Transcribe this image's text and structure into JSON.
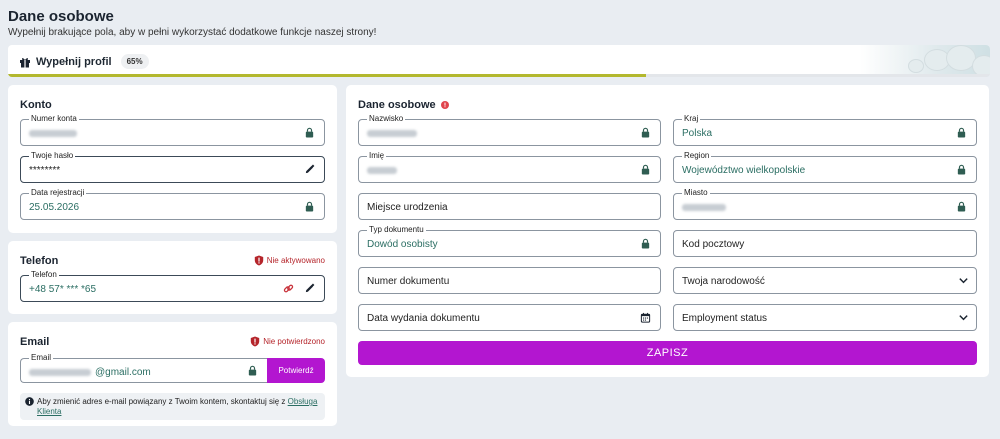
{
  "page": {
    "title": "Dane osobowe",
    "subtitle": "Wypełnij brakujące pola, aby w pełni wykorzystać dodatkowe funkcje naszej strony!"
  },
  "progress": {
    "label": "Wypełnij profil",
    "percent_label": "65%",
    "fraction": 0.65,
    "color": "#b3b82e"
  },
  "konto": {
    "title": "Konto",
    "account_number": {
      "label": "Numer konta"
    },
    "password": {
      "label": "Twoje hasło",
      "value": "********"
    },
    "registration_date": {
      "label": "Data rejestracji",
      "value": "25.05.2026"
    }
  },
  "telefon": {
    "title": "Telefon",
    "status": "Nie aktywowano",
    "phone": {
      "label": "Telefon",
      "value": "+48 57* *** *65"
    }
  },
  "email": {
    "title": "Email",
    "status": "Nie potwierdzono",
    "field": {
      "label": "Email",
      "suffix": "@gmail.com"
    },
    "confirm_label": "Potwierdź",
    "info_text": "Aby zmienić adres e-mail powiązany z Twoim kontem, skontaktuj się z ",
    "info_link": "Obsługa Klienta"
  },
  "personal": {
    "title": "Dane osobowe",
    "surname": {
      "label": "Nazwisko"
    },
    "first_name": {
      "label": "Imię"
    },
    "birthplace": {
      "placeholder": "Miejsce urodzenia"
    },
    "document_type": {
      "label": "Typ dokumentu",
      "value": "Dowód osobisty"
    },
    "document_number": {
      "placeholder": "Numer dokumentu"
    },
    "issue_date": {
      "placeholder": "Data wydania dokumentu"
    },
    "country": {
      "label": "Kraj",
      "value": "Polska"
    },
    "region": {
      "label": "Region",
      "value": "Województwo wielkopolskie"
    },
    "city": {
      "label": "Miasto"
    },
    "postal_code": {
      "placeholder": "Kod pocztowy"
    },
    "nationality": {
      "placeholder": "Twoja narodowość"
    },
    "employment": {
      "placeholder": "Employment status"
    },
    "save_label": "ZAPISZ"
  },
  "colors": {
    "accent": "#b316d0",
    "value_text": "#2b6e63",
    "warning": "#b5252b",
    "lock": "#2f5d52"
  },
  "icons": [
    "gift-icon",
    "lock-icon",
    "pencil-icon",
    "shield-alert-icon",
    "link-icon",
    "calendar-icon",
    "chevron-down-icon",
    "info-icon"
  ]
}
